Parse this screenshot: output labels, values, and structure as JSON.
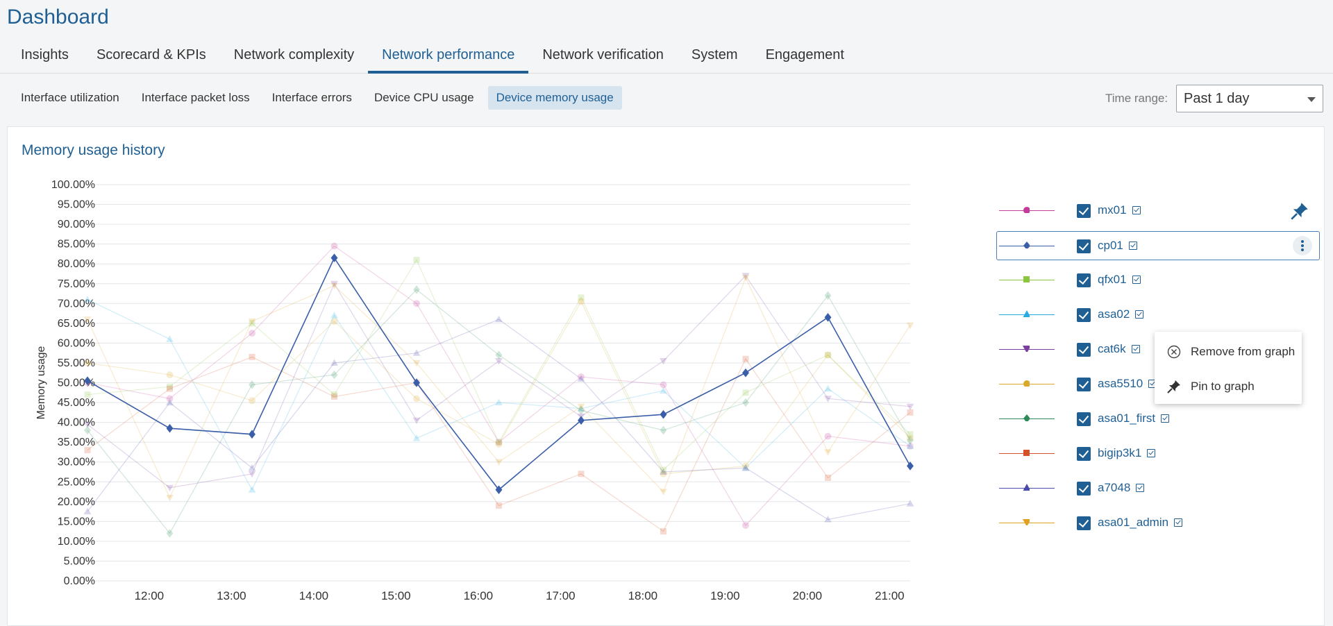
{
  "app": {
    "title": "Dashboard"
  },
  "tabs": [
    {
      "label": "Insights"
    },
    {
      "label": "Scorecard & KPIs"
    },
    {
      "label": "Network complexity"
    },
    {
      "label": "Network performance"
    },
    {
      "label": "Network verification"
    },
    {
      "label": "System"
    },
    {
      "label": "Engagement"
    }
  ],
  "active_tab": "Network performance",
  "subtabs": [
    {
      "label": "Interface utilization"
    },
    {
      "label": "Interface packet loss"
    },
    {
      "label": "Interface errors"
    },
    {
      "label": "Device CPU usage"
    },
    {
      "label": "Device memory usage"
    }
  ],
  "active_subtab": "Device memory usage",
  "time_range": {
    "label": "Time range:",
    "value": "Past 1 day"
  },
  "card": {
    "title": "Memory usage history"
  },
  "context_menu": {
    "remove_label": "Remove from graph",
    "pin_label": "Pin to graph"
  },
  "chart_data": {
    "type": "line",
    "title": "Memory usage history",
    "ylabel": "Memory usage",
    "ylim": [
      0,
      100
    ],
    "ytick_step": 5,
    "ytick_format": "percent_2dp",
    "xtick_labels": [
      "12:00",
      "13:00",
      "14:00",
      "15:00",
      "16:00",
      "17:00",
      "18:00",
      "19:00",
      "20:00",
      "21:00"
    ],
    "x": [
      "11:15",
      "12:15",
      "13:15",
      "14:15",
      "15:15",
      "16:15",
      "17:15",
      "18:15",
      "19:15",
      "20:15",
      "21:15"
    ],
    "grid": true,
    "highlighted_series": "cp01",
    "series": [
      {
        "name": "mx01",
        "color": "#c33c9a",
        "marker": "circle",
        "values": [
          50,
          46,
          62.5,
          84.5,
          70,
          35,
          51.5,
          49.5,
          14,
          36.5,
          34
        ]
      },
      {
        "name": "cp01",
        "color": "#3b5ea8",
        "marker": "diamond",
        "values": [
          50.5,
          38.5,
          37,
          81.5,
          50,
          23,
          40.5,
          42,
          52.5,
          66.5,
          29
        ]
      },
      {
        "name": "qfx01",
        "color": "#8cc63f",
        "marker": "square",
        "values": [
          47,
          49,
          65,
          47,
          81,
          35,
          71.5,
          28,
          47.5,
          57,
          37
        ]
      },
      {
        "name": "asa02",
        "color": "#29abe2",
        "marker": "triangle-up",
        "values": [
          71,
          61,
          23,
          67,
          36,
          45,
          43.5,
          48,
          28.5,
          48.5,
          34
        ]
      },
      {
        "name": "cat6k",
        "color": "#7b3fa0",
        "marker": "triangle-down",
        "values": [
          39.5,
          23.5,
          27,
          75,
          40.5,
          55.5,
          41.5,
          55.5,
          77,
          46,
          44
        ]
      },
      {
        "name": "asa5510",
        "color": "#d9a92b",
        "marker": "circle",
        "values": [
          55,
          52,
          45.5,
          65.5,
          46,
          34.5,
          70.5,
          27,
          29,
          57,
          36
        ]
      },
      {
        "name": "asa01_first",
        "color": "#2e8b57",
        "marker": "diamond",
        "values": [
          38,
          12,
          49.5,
          52,
          73.5,
          57,
          43,
          38,
          45,
          72,
          35.5
        ]
      },
      {
        "name": "bigip3k1",
        "color": "#d4522a",
        "marker": "square",
        "values": [
          33,
          48.5,
          56.5,
          46.5,
          50,
          19,
          27,
          12.5,
          56,
          26,
          42.5
        ]
      },
      {
        "name": "a7048",
        "color": "#4a4aa8",
        "marker": "triangle-up",
        "values": [
          17.5,
          45,
          28.5,
          55,
          57.5,
          66,
          51,
          27.5,
          28.5,
          15.5,
          19.5
        ]
      },
      {
        "name": "asa01_admin",
        "color": "#e0a020",
        "marker": "triangle-down",
        "values": [
          66,
          21,
          65.5,
          74.5,
          55,
          30,
          44,
          22.5,
          76.5,
          32.5,
          64.5
        ]
      }
    ]
  }
}
